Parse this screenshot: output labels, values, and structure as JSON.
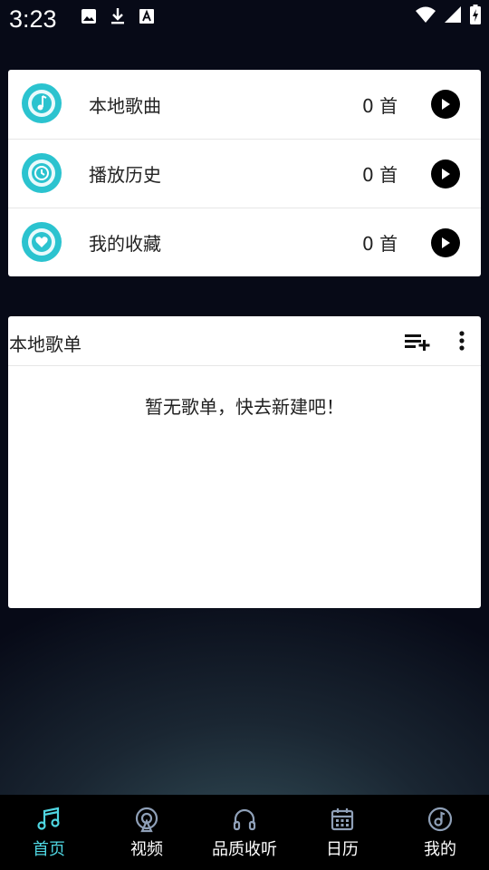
{
  "status_bar": {
    "time": "3:23"
  },
  "quick_list": [
    {
      "label": "本地歌曲",
      "count": "0 首",
      "icon": "music-note-icon"
    },
    {
      "label": "播放历史",
      "count": "0 首",
      "icon": "clock-icon"
    },
    {
      "label": "我的收藏",
      "count": "0 首",
      "icon": "heart-icon"
    }
  ],
  "playlist_section": {
    "title": "本地歌单",
    "empty_message": "暂无歌单，快去新建吧！"
  },
  "bottom_nav": [
    {
      "label": "首页",
      "icon": "music-notes-icon",
      "active": true
    },
    {
      "label": "视频",
      "icon": "broadcast-icon",
      "active": false
    },
    {
      "label": "品质收听",
      "icon": "headphones-icon",
      "active": false
    },
    {
      "label": "日历",
      "icon": "calendar-icon",
      "active": false
    },
    {
      "label": "我的",
      "icon": "disc-icon",
      "active": false
    }
  ],
  "colors": {
    "accent": "#4fd6e2",
    "icon_teal": "#2bc3cf",
    "background": "#05060f"
  }
}
